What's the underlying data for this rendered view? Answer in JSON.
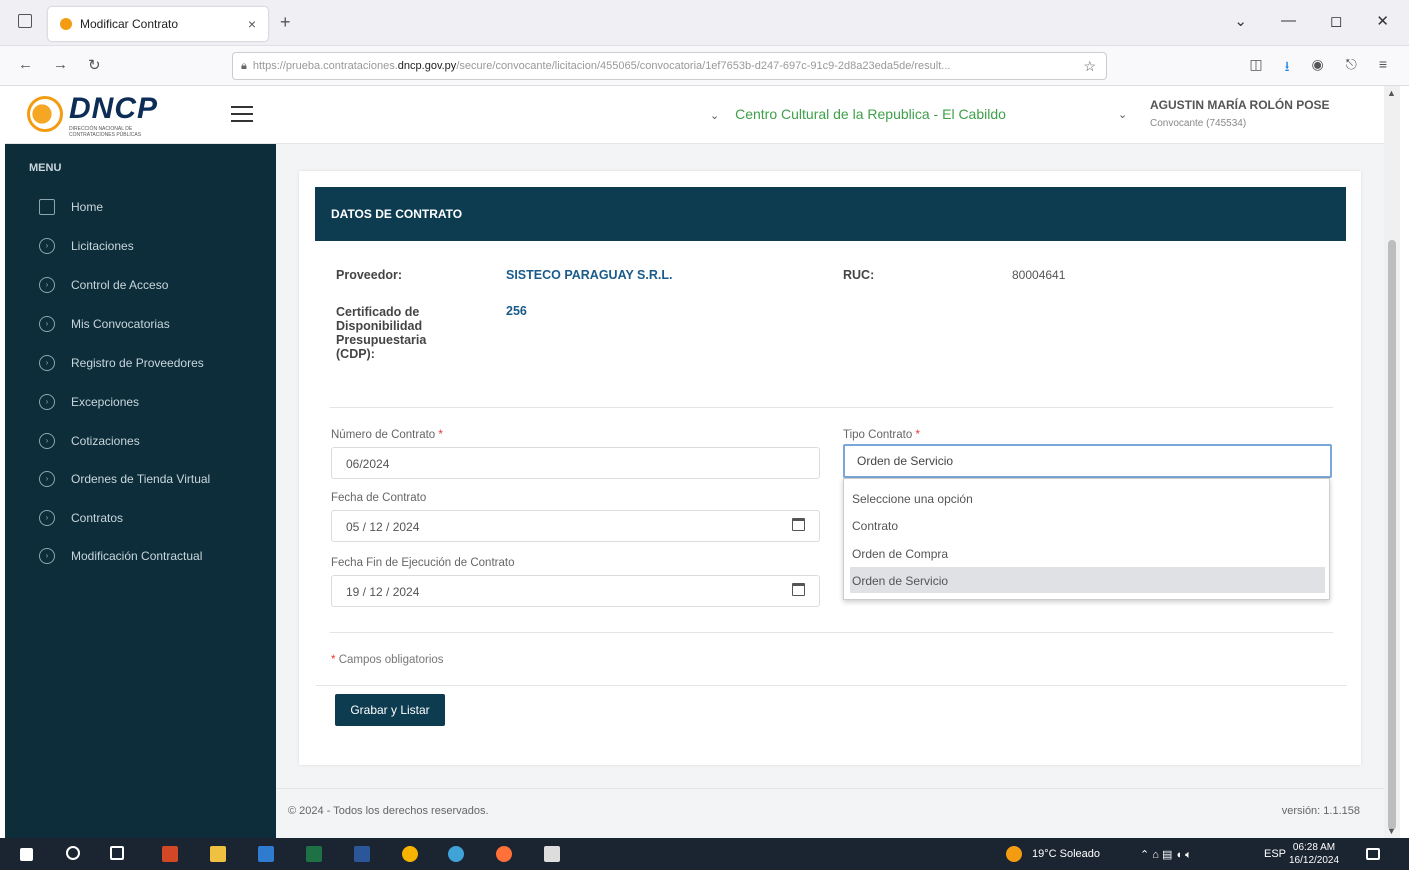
{
  "browser": {
    "tab_title": "Modificar Contrato",
    "close_glyph": "×",
    "newtab_glyph": "+",
    "url_prefix": "https://prueba.contrataciones.",
    "url_domain": "dncp.gov.py",
    "url_rest": "/secure/convocante/licitacion/455065/convocatoria/1ef7653b-d247-697c-91c9-2d8a23eda5de/result...",
    "window_controls": [
      "⌄",
      "—",
      "◻",
      "✕"
    ]
  },
  "header": {
    "logo_text": "DNCP",
    "logo_sub": "DIRECCIÓN NACIONAL DE CONTRATACIONES PÚBLICAS",
    "entity": "Centro Cultural de la Republica - El Cabildo",
    "user_name": "AGUSTIN MARÍA ROLÓN POSE",
    "user_role": "Convocante (745534)"
  },
  "sidebar": {
    "title": "MENU",
    "items": [
      {
        "label": "Home"
      },
      {
        "label": "Licitaciones"
      },
      {
        "label": "Control de Acceso"
      },
      {
        "label": "Mis Convocatorias"
      },
      {
        "label": "Registro de Proveedores"
      },
      {
        "label": "Excepciones"
      },
      {
        "label": "Cotizaciones"
      },
      {
        "label": "Ordenes de Tienda Virtual"
      },
      {
        "label": "Contratos"
      },
      {
        "label": "Modificación Contractual"
      }
    ]
  },
  "card": {
    "title": "DATOS DE CONTRATO",
    "proveedor_label": "Proveedor:",
    "proveedor_value": "SISTECO PARAGUAY S.R.L.",
    "ruc_label": "RUC:",
    "ruc_value": "80004641",
    "cdp_label": "Certificado de Disponibilidad Presupuestaria (CDP):",
    "cdp_value": "256"
  },
  "form": {
    "numero_label": "Número de Contrato",
    "numero_value": "06/2024",
    "fecha_label": "Fecha de Contrato",
    "fecha_value": "05 / 12 / 2024",
    "fecha_fin_label": "Fecha Fin de Ejecución de Contrato",
    "fecha_fin_value": "19 / 12 / 2024",
    "tipo_label": "Tipo Contrato",
    "tipo_value": "Orden de Servicio",
    "tipo_options": [
      "Seleccione una opción",
      "Contrato",
      "Orden de Compra",
      "Orden de Servicio"
    ],
    "required_mark": "*",
    "required_note": "Campos obligatorios",
    "save_label": "Grabar y Listar"
  },
  "footer": {
    "copyright": "© 2024 - Todos los derechos reservados.",
    "version": "versión: 1.1.158"
  },
  "taskbar": {
    "weather": "19°C  Soleado",
    "lang": "ESP",
    "time": "06:28 AM",
    "date": "16/12/2024"
  }
}
